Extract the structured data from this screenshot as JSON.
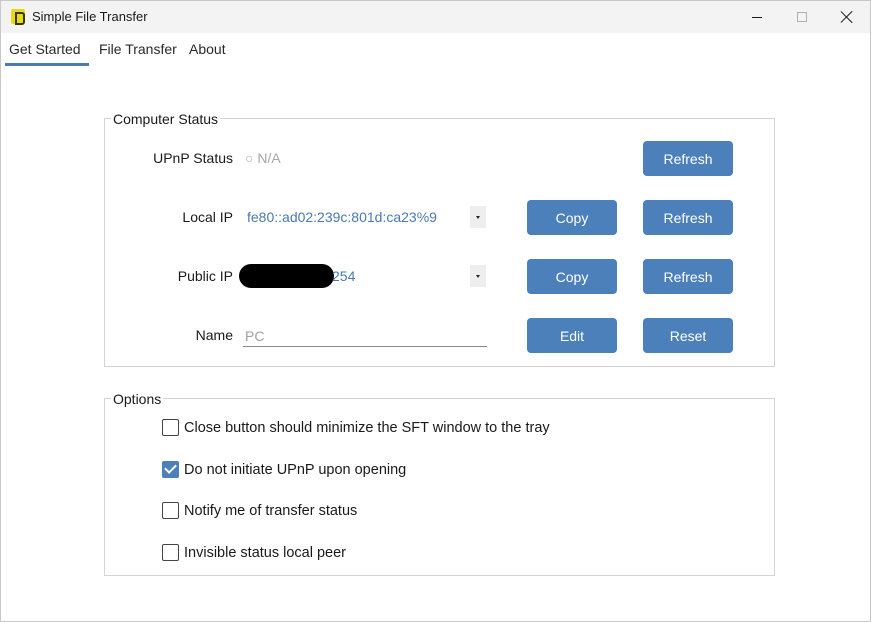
{
  "window": {
    "title": "Simple File Transfer"
  },
  "tabs": [
    {
      "label": "Get Started",
      "active": true
    },
    {
      "label": "File Transfer",
      "active": false
    },
    {
      "label": "About",
      "active": false
    }
  ],
  "computer_status": {
    "title": "Computer Status",
    "upnp": {
      "label": "UPnP Status",
      "value": "○ N/A",
      "refresh_label": "Refresh"
    },
    "local_ip": {
      "label": "Local IP",
      "value": "fe80::ad02:239c:801d:ca23%9",
      "copy_label": "Copy",
      "refresh_label": "Refresh"
    },
    "public_ip": {
      "label": "Public IP",
      "value_suffix": "254",
      "copy_label": "Copy",
      "refresh_label": "Refresh"
    },
    "name": {
      "label": "Name",
      "placeholder": "PC",
      "edit_label": "Edit",
      "reset_label": "Reset"
    }
  },
  "options": {
    "title": "Options",
    "items": [
      {
        "label": "Close button should minimize the SFT window to the tray",
        "checked": false
      },
      {
        "label": "Do not initiate UPnP upon opening",
        "checked": true
      },
      {
        "label": "Notify me of transfer status",
        "checked": false
      },
      {
        "label": "Invisible status local peer",
        "checked": false
      }
    ]
  },
  "colors": {
    "accent": "#4b80bb",
    "link_text": "#4a7ab0",
    "muted_text": "#a8a8a8"
  }
}
